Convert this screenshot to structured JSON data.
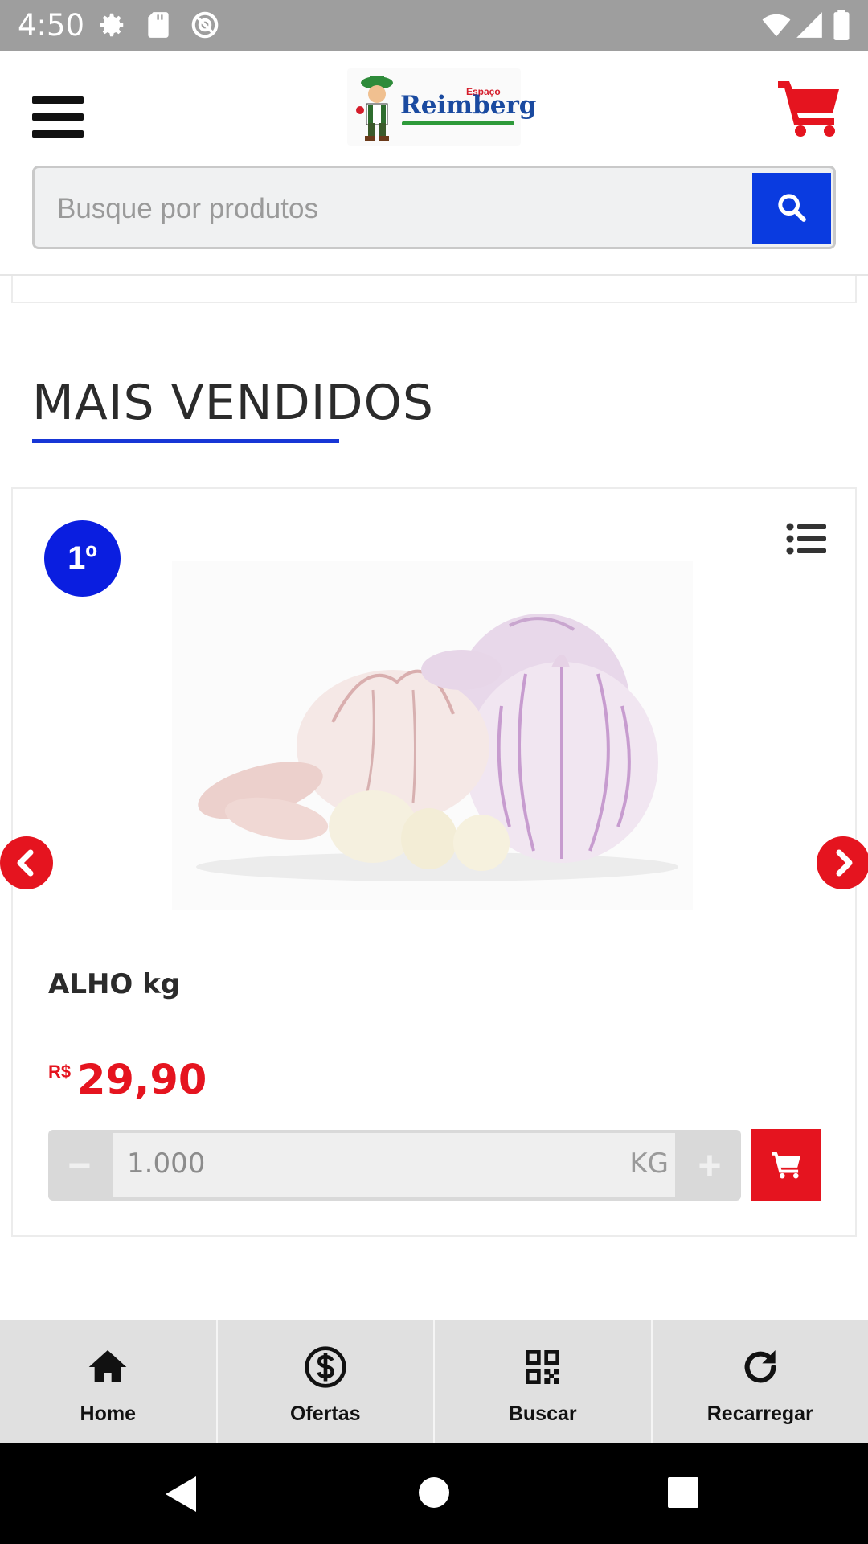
{
  "status_bar": {
    "time": "4:50"
  },
  "header": {
    "logo": {
      "brand": "Reimberg",
      "sub": "Espaço"
    },
    "search": {
      "placeholder": "Busque por produtos"
    }
  },
  "section": {
    "title": "MAIS VENDIDOS"
  },
  "product": {
    "rank": "1º",
    "name": "ALHO kg",
    "currency": "R$",
    "price": "29,90",
    "quantity": "1.000",
    "unit": "KG",
    "minus": "−",
    "plus": "+"
  },
  "bottom_nav": {
    "items": [
      {
        "label": "Home",
        "icon": "home-icon"
      },
      {
        "label": "Ofertas",
        "icon": "dollar-icon"
      },
      {
        "label": "Buscar",
        "icon": "qr-code-icon"
      },
      {
        "label": "Recarregar",
        "icon": "refresh-icon"
      }
    ]
  },
  "colors": {
    "primary_blue": "#0a3be0",
    "accent_red": "#e5141f"
  }
}
